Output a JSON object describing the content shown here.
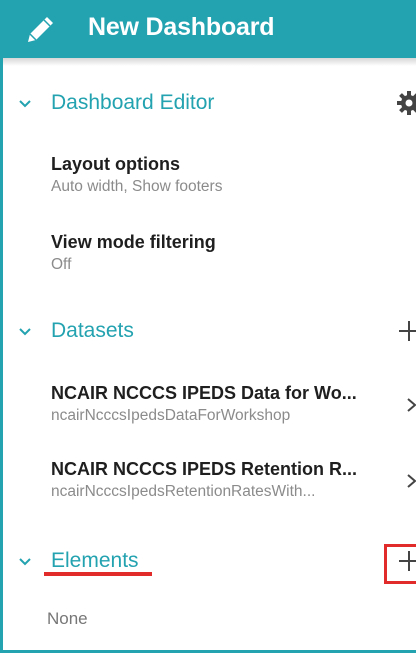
{
  "header": {
    "title": "New Dashboard",
    "icon": "pencil-icon",
    "background_color": "#23a2b0"
  },
  "dashboard_editor": {
    "label": "Dashboard Editor",
    "settings_icon": "gear-icon",
    "items": [
      {
        "title": "Layout options",
        "subtitle": "Auto width, Show footers"
      },
      {
        "title": "View mode filtering",
        "subtitle": "Off"
      }
    ]
  },
  "datasets": {
    "label": "Datasets",
    "add_icon": "plus-icon",
    "items": [
      {
        "title": "NCAIR NCCCS IPEDS Data for Wo...",
        "subtitle": "ncairNcccsIpedsDataForWorkshop"
      },
      {
        "title": "NCAIR NCCCS IPEDS Retention R...",
        "subtitle": "ncairNcccsIpedsRetentionRatesWith..."
      }
    ]
  },
  "elements": {
    "label": "Elements",
    "add_icon": "plus-icon",
    "empty_text": "None"
  },
  "colors": {
    "accent": "#23a2b0",
    "highlight": "#e12a2a"
  }
}
